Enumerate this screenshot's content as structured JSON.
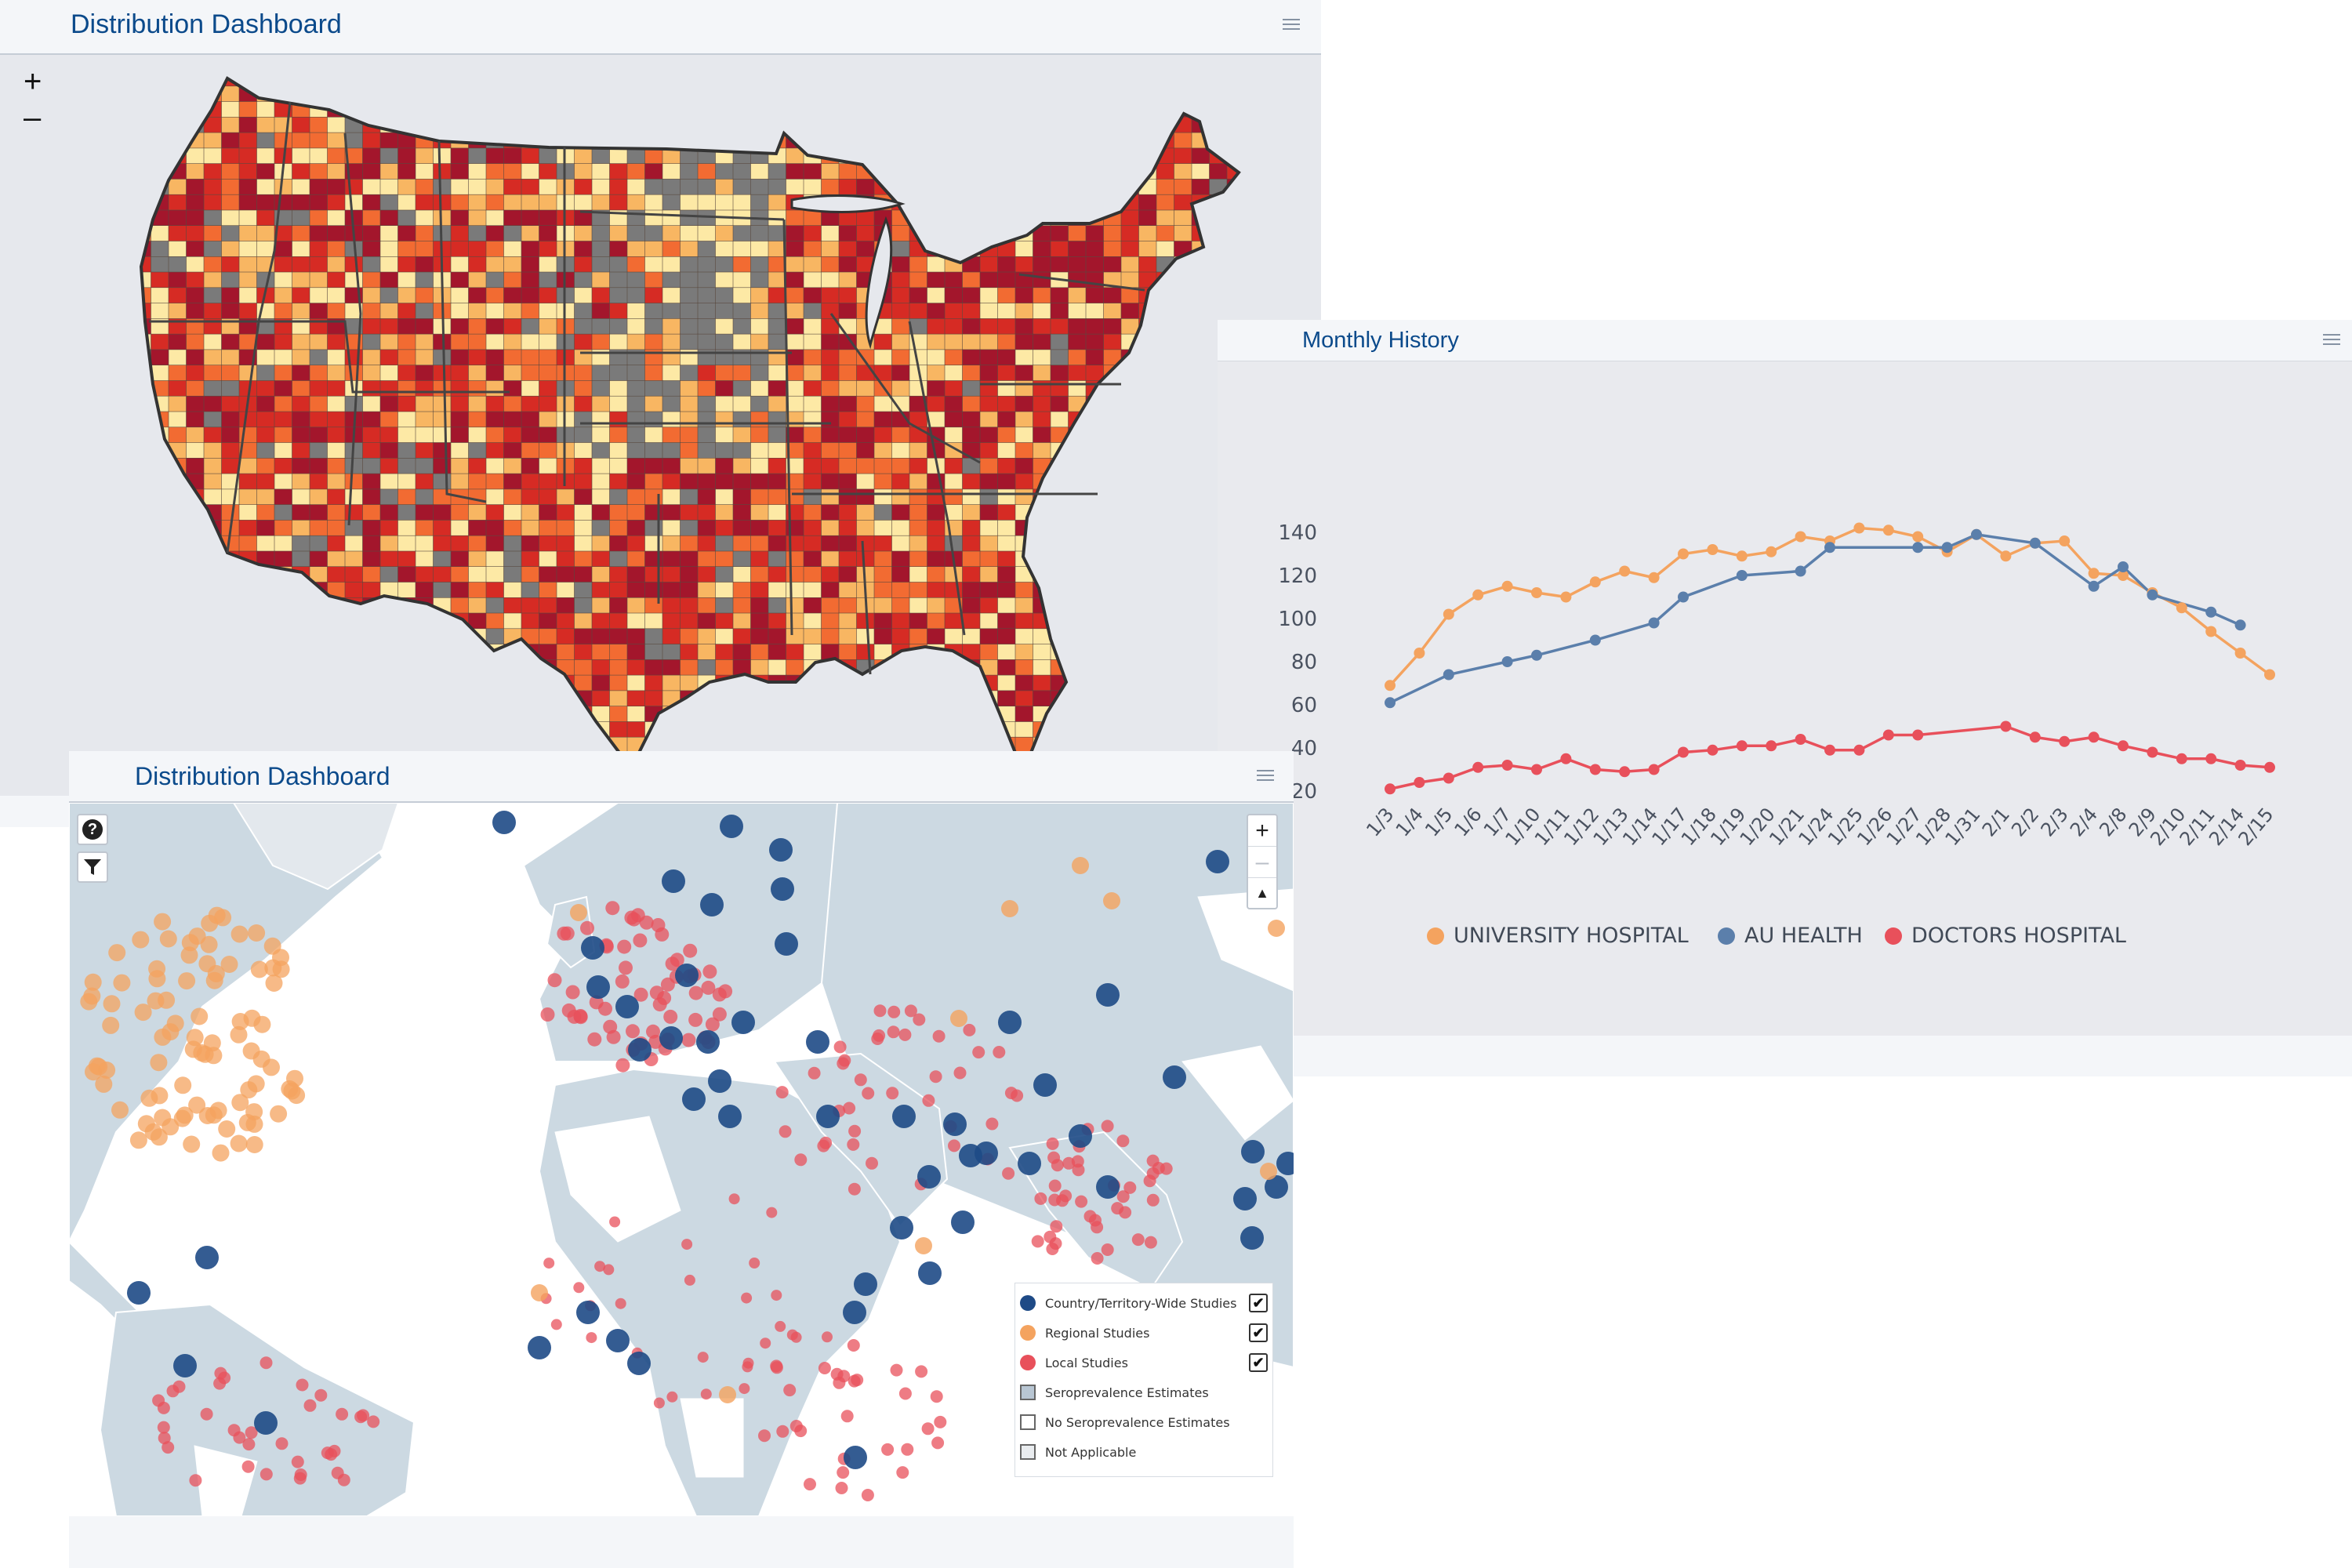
{
  "us_map_panel": {
    "title": "Distribution Dashboard",
    "zoom_in": "+",
    "zoom_out": "–"
  },
  "history_panel": {
    "title": "Monthly History"
  },
  "world_map_panel": {
    "title": "Distribution Dashboard",
    "help_icon": "?",
    "zoom_in": "+",
    "zoom_out": "–",
    "reset_north": "▲",
    "legend": [
      {
        "label": "Country/Territory-Wide Studies",
        "symbol": "circle",
        "color": "#1e4a86",
        "checked": true
      },
      {
        "label": "Regional Studies",
        "symbol": "circle",
        "color": "#f4a35f",
        "checked": true
      },
      {
        "label": "Local Studies",
        "symbol": "circle",
        "color": "#e8505b",
        "checked": true
      },
      {
        "label": "Seroprevalence Estimates",
        "symbol": "square",
        "color": "#b8c6d3",
        "checked": null
      },
      {
        "label": "No Seroprevalence Estimates",
        "symbol": "square",
        "color": "#ffffff",
        "checked": null
      },
      {
        "label": "Not Applicable",
        "symbol": "square",
        "color": "#e9ecef",
        "checked": null
      }
    ]
  },
  "colors": {
    "map_choropleth": [
      "#fde9a5",
      "#f8b662",
      "#f26b32",
      "#d62b24",
      "#a3162c",
      "#7a7a7a"
    ],
    "university": "#f4a35f",
    "au_health": "#5b7fab",
    "doctors": "#e8505b"
  },
  "chart_data": {
    "type": "line",
    "title": "Monthly History",
    "categories": [
      "1/3",
      "1/4",
      "1/5",
      "1/6",
      "1/7",
      "1/10",
      "1/11",
      "1/12",
      "1/13",
      "1/14",
      "1/17",
      "1/18",
      "1/19",
      "1/20",
      "1/21",
      "1/24",
      "1/25",
      "1/26",
      "1/27",
      "1/28",
      "1/31",
      "2/1",
      "2/2",
      "2/3",
      "2/4",
      "2/8",
      "2/9",
      "2/10",
      "2/11",
      "2/14",
      "2/15"
    ],
    "ylim": [
      20,
      140
    ],
    "yticks": [
      20,
      40,
      60,
      80,
      100,
      120,
      140
    ],
    "grid": false,
    "legend_position": "bottom",
    "series": [
      {
        "name": "UNIVERSITY HOSPITAL",
        "color": "#f4a35f",
        "values": [
          69,
          84,
          102,
          111,
          115,
          112,
          110,
          117,
          122,
          119,
          130,
          132,
          129,
          131,
          138,
          136,
          142,
          141,
          138,
          131,
          139,
          129,
          135,
          136,
          121,
          120,
          112,
          105,
          94,
          84,
          74
        ]
      },
      {
        "name": "AU HEALTH",
        "color": "#5b7fab",
        "values": [
          61,
          null,
          74,
          null,
          80,
          83,
          null,
          90,
          null,
          98,
          110,
          null,
          120,
          null,
          122,
          133,
          null,
          null,
          133,
          133,
          139,
          null,
          135,
          null,
          115,
          124,
          111,
          null,
          103,
          97,
          null
        ]
      },
      {
        "name": "DOCTORS HOSPITAL",
        "color": "#e8505b",
        "values": [
          21,
          24,
          26,
          31,
          32,
          30,
          35,
          30,
          29,
          30,
          38,
          39,
          41,
          41,
          44,
          39,
          39,
          46,
          46,
          null,
          null,
          50,
          45,
          43,
          45,
          41,
          38,
          35,
          35,
          32,
          31
        ]
      }
    ]
  }
}
